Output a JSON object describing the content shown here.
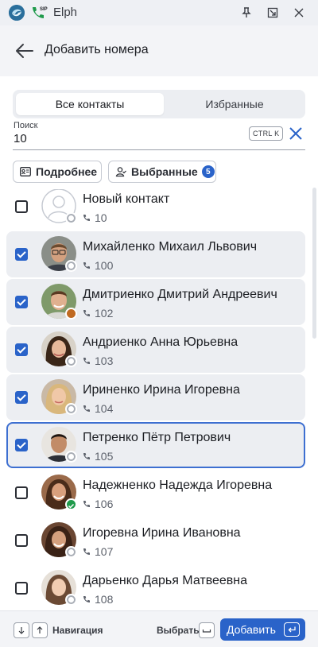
{
  "window": {
    "title": "Elph",
    "sip_badge": "SIP"
  },
  "header": {
    "title": "Добавить номера"
  },
  "tabs": [
    {
      "label": "Все контакты",
      "active": true
    },
    {
      "label": "Избранные",
      "active": false
    }
  ],
  "search": {
    "label": "Поиск",
    "value": "10",
    "shortcut": "CTRL K"
  },
  "filters": {
    "details_label": "Подробнее",
    "selected_label": "Выбранные",
    "selected_count": "5"
  },
  "contacts": [
    {
      "name": "Новый контакт",
      "ext": "10",
      "checked": false,
      "status": "offline",
      "avatar": "placeholder"
    },
    {
      "name": "Михайленко Михаил Львович",
      "ext": "100",
      "checked": true,
      "status": "offline",
      "avatar": "man-glasses"
    },
    {
      "name": "Дмитриенко Дмитрий Андреевич",
      "ext": "102",
      "checked": true,
      "status": "away",
      "avatar": "man-smile"
    },
    {
      "name": "Андриенко Анна Юрьевна",
      "ext": "103",
      "checked": true,
      "status": "offline",
      "avatar": "woman-dark"
    },
    {
      "name": "Ириненко Ирина Игоревна",
      "ext": "104",
      "checked": true,
      "status": "offline",
      "avatar": "woman-blonde"
    },
    {
      "name": "Петренко Пётр Петрович",
      "ext": "105",
      "checked": true,
      "status": "offline",
      "avatar": "man-dark"
    },
    {
      "name": "Надежненко Надежда Игоревна",
      "ext": "106",
      "checked": false,
      "status": "online",
      "avatar": "woman-brown"
    },
    {
      "name": "Игоревна Ирина Ивановна",
      "ext": "107",
      "checked": false,
      "status": "offline",
      "avatar": "woman-curly"
    },
    {
      "name": "Дарьенко Дарья Матвеевна",
      "ext": "108",
      "checked": false,
      "status": "offline",
      "avatar": "woman-light"
    }
  ],
  "footer": {
    "navigation_label": "Навигация",
    "select_label": "Выбрать",
    "add_button_label": "Добавить"
  },
  "colors": {
    "accent": "#2a63c9",
    "online": "#1f9a4b",
    "away": "#c06a22"
  }
}
